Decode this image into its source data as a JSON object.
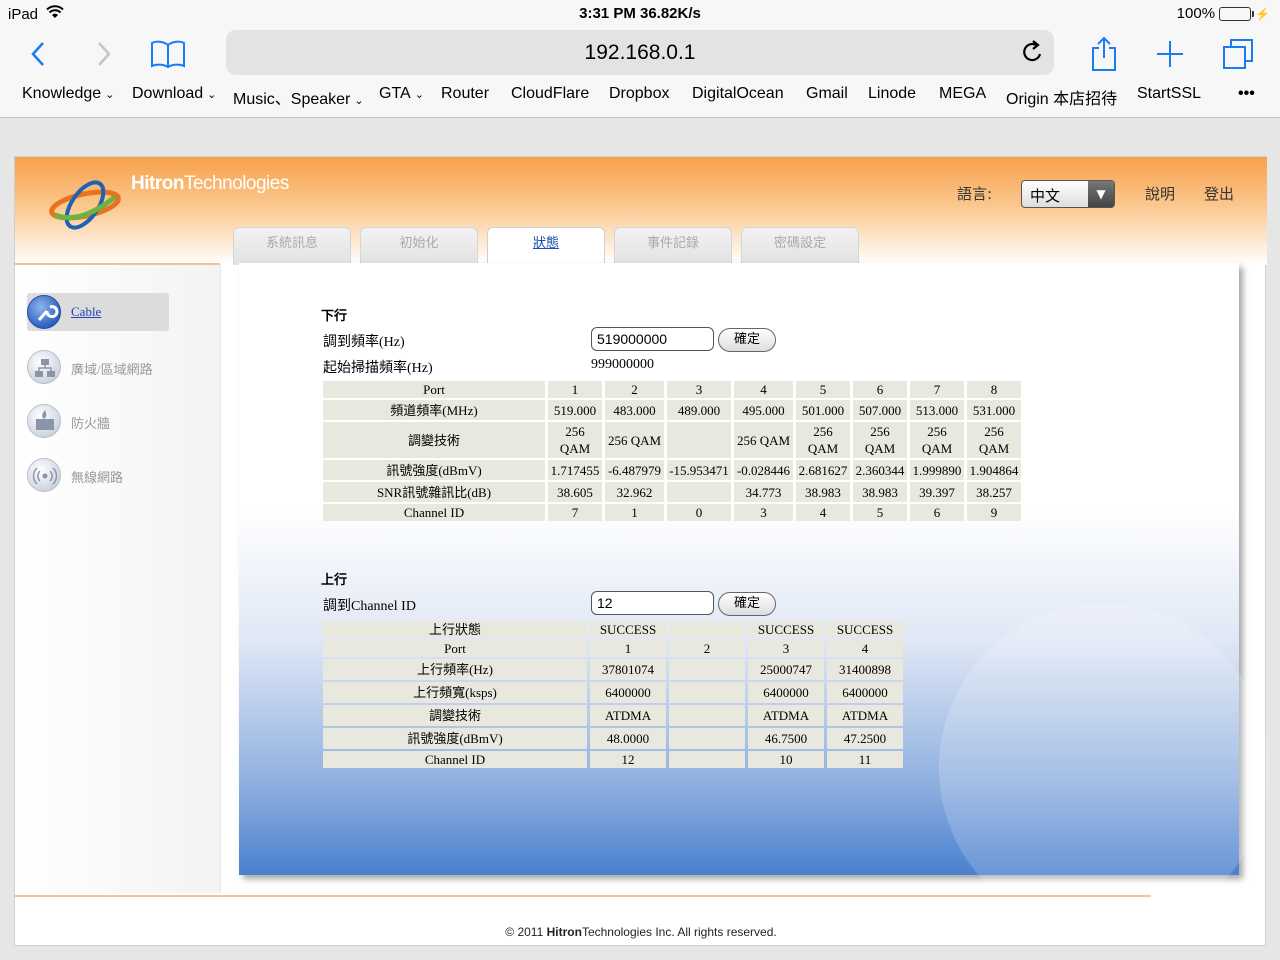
{
  "status_bar": {
    "device": "iPad",
    "time_speed": "3:31 PM 36.82K/s",
    "battery": "100%",
    "battery_level": 1.0
  },
  "safari": {
    "url": "192.168.0.1",
    "bookmarks": [
      {
        "label": "Knowledge",
        "folder": true
      },
      {
        "label": "Download",
        "folder": true
      },
      {
        "label": "Music、Speaker",
        "folder": true
      },
      {
        "label": "GTA",
        "folder": true
      },
      {
        "label": "Router",
        "folder": false
      },
      {
        "label": "CloudFlare",
        "folder": false
      },
      {
        "label": "Dropbox",
        "folder": false
      },
      {
        "label": "DigitalOcean",
        "folder": false
      },
      {
        "label": "Gmail",
        "folder": false
      },
      {
        "label": "Linode",
        "folder": false
      },
      {
        "label": "MEGA",
        "folder": false
      },
      {
        "label": "Origin 本店招待",
        "folder": false
      },
      {
        "label": "StartSSL",
        "folder": false
      }
    ],
    "more": "•••"
  },
  "router": {
    "brand_bold": "Hitron",
    "brand_rest": "Technologies",
    "lang_label": "語言:",
    "lang_value": "中文",
    "help": "說明",
    "logout": "登出",
    "tabs": [
      "系統訊息",
      "初始化",
      "狀態",
      "事件記錄",
      "密碼設定"
    ],
    "active_tab": "狀態",
    "sidebar": [
      "Cable",
      "廣域/區域網路",
      "防火牆",
      "無線網路"
    ],
    "downstream": {
      "title": "下行",
      "tune_label": "調到頻率(Hz)",
      "tune_value": "519000000",
      "confirm": "確定",
      "scan_label": "起始掃描頻率(Hz)",
      "scan_value": "999000000",
      "rows": [
        [
          "Port",
          "1",
          "2",
          "3",
          "4",
          "5",
          "6",
          "7",
          "8"
        ],
        [
          "頻道頻率(MHz)",
          "519.000",
          "483.000",
          "489.000",
          "495.000",
          "501.000",
          "507.000",
          "513.000",
          "531.000"
        ],
        [
          "調變技術",
          "256 QAM",
          "256 QAM",
          "",
          "256 QAM",
          "256 QAM",
          "256 QAM",
          "256 QAM",
          "256 QAM"
        ],
        [
          "訊號強度(dBmV)",
          "1.717455",
          "-6.487979",
          "-15.953471",
          "-0.028446",
          "2.681627",
          "2.360344",
          "1.999890",
          "1.904864"
        ],
        [
          "SNR訊號雜訊比(dB)",
          "38.605",
          "32.962",
          "",
          "34.773",
          "38.983",
          "38.983",
          "39.397",
          "38.257"
        ],
        [
          "Channel ID",
          "7",
          "1",
          "0",
          "3",
          "4",
          "5",
          "6",
          "9"
        ]
      ]
    },
    "upstream": {
      "title": "上行",
      "channel_label": "調到Channel ID",
      "channel_value": "12",
      "confirm": "確定",
      "rows": [
        [
          "上行狀態",
          "SUCCESS",
          "",
          "SUCCESS",
          "SUCCESS"
        ],
        [
          "Port",
          "1",
          "2",
          "3",
          "4"
        ],
        [
          "上行頻率(Hz)",
          "37801074",
          "",
          "25000747",
          "31400898"
        ],
        [
          "上行頻寬(ksps)",
          "6400000",
          "",
          "6400000",
          "6400000"
        ],
        [
          "調變技術",
          "ATDMA",
          "",
          "ATDMA",
          "ATDMA"
        ],
        [
          "訊號強度(dBmV)",
          "48.0000",
          "",
          "46.7500",
          "47.2500"
        ],
        [
          "Channel ID",
          "12",
          "",
          "10",
          "11"
        ]
      ]
    },
    "footer_prefix": "© 2011 ",
    "footer_brand_bold": "Hitron",
    "footer_brand_rest": "Technologies",
    "footer_suffix": " Inc.  All rights reserved."
  }
}
